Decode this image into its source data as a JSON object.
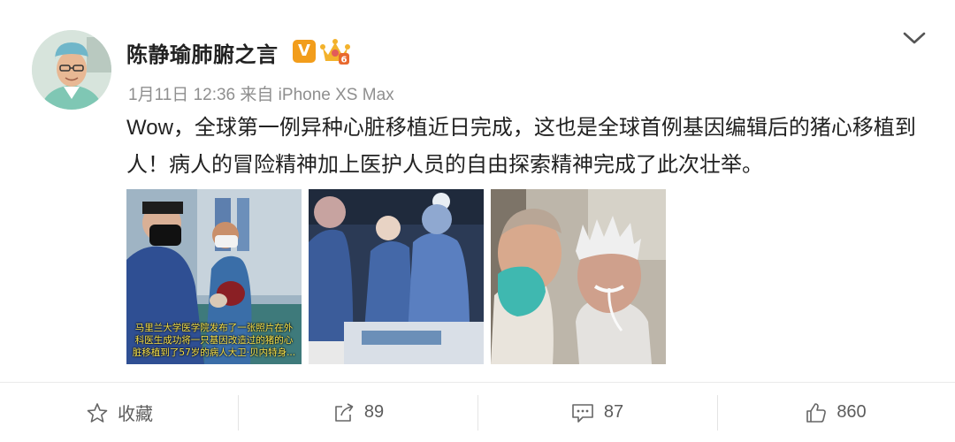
{
  "post": {
    "author": {
      "name": "陈静瑜肺腑之言",
      "verified_badge": "V",
      "level_badge": "6"
    },
    "meta": "1月11日 12:36 来自 iPhone XS Max",
    "text": "Wow，全球第一例异种心脏移植近日完成，这也是全球首例基因编辑后的猪心移植到人！病人的冒险精神加上医护人员的自由探索精神完成了此次壮举。",
    "images": [
      {
        "caption": "马里兰大学医学院发布了一张照片在外科医生成功将一只基因改造过的猪的心脏移植到了57岁的病人大卫·贝内特身..."
      },
      {},
      {}
    ]
  },
  "actions": {
    "favorite_label": "收藏",
    "repost_count": "89",
    "comment_count": "87",
    "like_count": "860"
  },
  "colors": {
    "verified_orange": "#f29d1b",
    "text_primary": "#222222",
    "text_meta": "#8f8f8f",
    "caption_yellow": "#f6e04a"
  },
  "icons": {
    "menu": "chevron-down-icon",
    "favorite": "star-icon",
    "repost": "share-icon",
    "comment": "comment-icon",
    "like": "thumbs-up-icon"
  }
}
